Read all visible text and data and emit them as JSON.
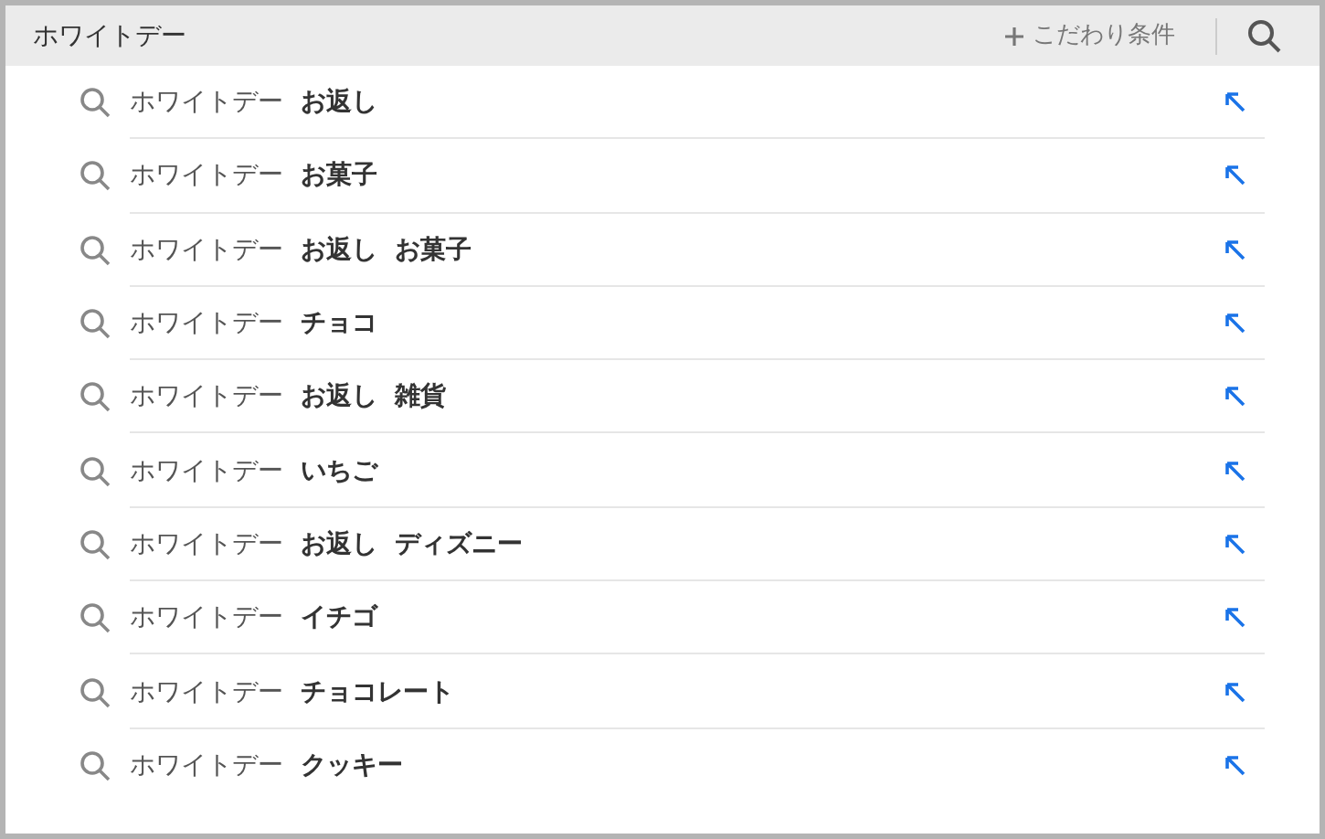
{
  "search": {
    "value": "ホワイトデー",
    "filter_label": "こだわり条件"
  },
  "suggestions": [
    {
      "text": "ホワイトデー **お返し**"
    },
    {
      "text": "ホワイトデー **お菓子**"
    },
    {
      "text": "ホワイトデー **お返し お菓子**"
    },
    {
      "text": "ホワイトデー **チョコ**"
    },
    {
      "text": "ホワイトデー **お返し 雑貨**"
    },
    {
      "text": "ホワイトデー **いちご**"
    },
    {
      "text": "ホワイトデー **お返し ディズニー**"
    },
    {
      "text": "ホワイトデー **イチゴ**"
    },
    {
      "text": "ホワイトデー **チョコレート**"
    },
    {
      "text": "ホワイトデー **クッキー**"
    }
  ]
}
